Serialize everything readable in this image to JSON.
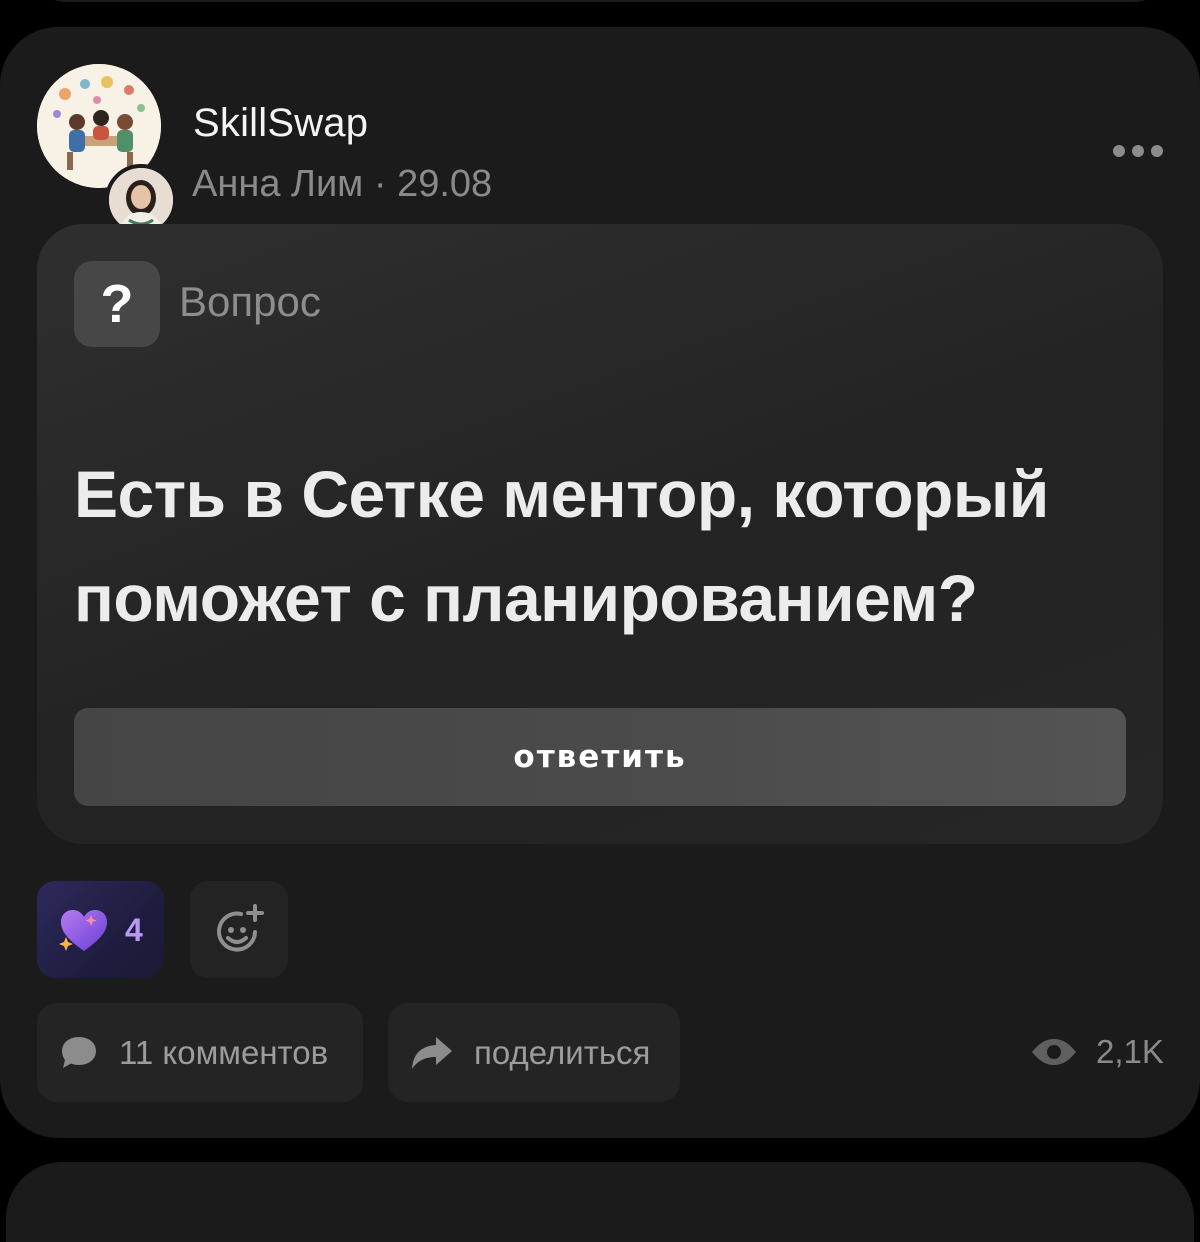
{
  "post": {
    "channel_name": "SkillSwap",
    "author_meta": "Анна Лим · 29.08",
    "more_icon": "more-horizontal-icon"
  },
  "question": {
    "badge_symbol": "?",
    "type_label": "Вопрос",
    "title": "Есть в Сетке ментор, который поможет с планированием?",
    "answer_label": "ответить"
  },
  "reactions": {
    "heart_count": "4",
    "heart_icon": "sparkle-heart-icon",
    "add_icon": "add-reaction-icon"
  },
  "footer": {
    "comments_label": "11 комментов",
    "share_label": "поделиться",
    "views_count": "2,1K"
  },
  "colors": {
    "background": "#000000",
    "card": "#1b1b1b",
    "accent_purple": "#b89af5"
  }
}
